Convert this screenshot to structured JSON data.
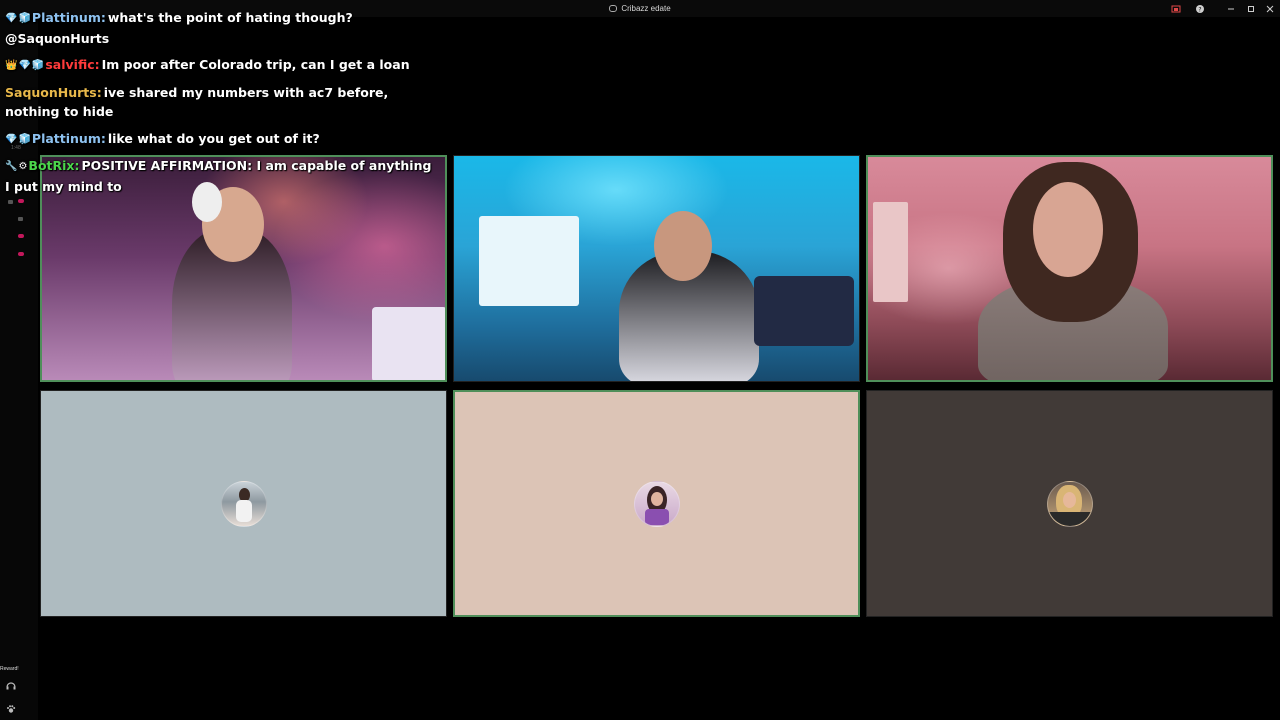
{
  "window": {
    "title": "Cribazz edate"
  },
  "chat": [
    {
      "badges": [
        "💎",
        "🧊"
      ],
      "user": "Plattinum:",
      "user_color": "#8ec2f0",
      "text": "what's the point of hating though? @SaquonHurts"
    },
    {
      "badges": [
        "👑",
        "💎",
        "🧊"
      ],
      "user": "salvific:",
      "user_color": "#ff3b3b",
      "text": "Im poor after Colorado trip, can I get a loan"
    },
    {
      "badges": [],
      "user": "SaquonHurts:",
      "user_color": "#e8b84a",
      "text": "ive shared my numbers with ac7 before, nothing to hide"
    },
    {
      "badges": [
        "💎",
        "🧊"
      ],
      "user": "Plattinum:",
      "user_color": "#8ec2f0",
      "text": "like what do you get out of it?"
    },
    {
      "badges": [
        "🔧",
        "⚙"
      ],
      "user": "BotRix:",
      "user_color": "#4bd64b",
      "text": "POSITIVE AFFIRMATION: I am capable of anything I put my mind to"
    }
  ],
  "sidebar": {
    "time": "1:48",
    "reward_label": "Reward!"
  },
  "tiles": [
    {
      "kind": "video",
      "speaking": true,
      "bg": "v1"
    },
    {
      "kind": "video",
      "speaking": false,
      "bg": "v2"
    },
    {
      "kind": "video",
      "speaking": true,
      "bg": "v3"
    },
    {
      "kind": "avatar",
      "speaking": false,
      "color": "#aebbc0"
    },
    {
      "kind": "avatar",
      "speaking": true,
      "color": "#dcc4b6"
    },
    {
      "kind": "avatar",
      "speaking": false,
      "color": "#413a37"
    }
  ],
  "colors": {
    "speaking_border": "#4f8f5a",
    "background": "#000000"
  }
}
